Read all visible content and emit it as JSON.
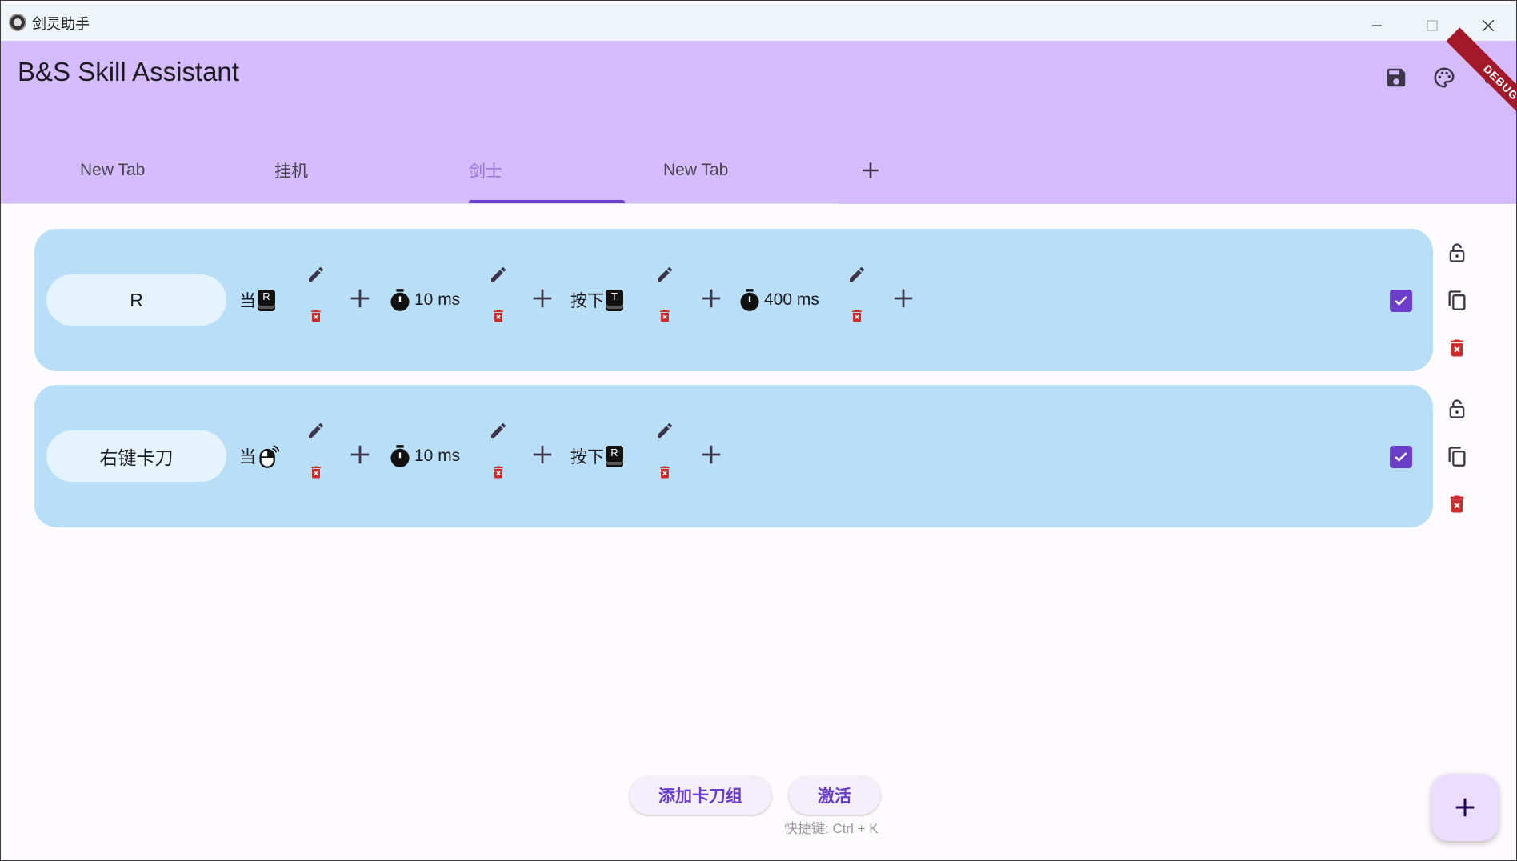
{
  "window": {
    "title": "剑灵助手"
  },
  "appbar": {
    "title": "B&S Skill Assistant",
    "debug_banner": "DEBUG"
  },
  "tabs": [
    {
      "label": "New Tab"
    },
    {
      "label": "挂机"
    },
    {
      "label": "剑士",
      "selected": true
    },
    {
      "label": "New Tab"
    }
  ],
  "rows": [
    {
      "name": "R",
      "trigger_label": "当",
      "trigger_key": "R",
      "delay1": "10 ms",
      "press_label": "按下",
      "press_key": "T",
      "delay2": "400 ms",
      "checked": true
    },
    {
      "name": "右键卡刀",
      "trigger_label": "当",
      "trigger_icon": "mouse-right-click-icon",
      "delay1": "10 ms",
      "press_label": "按下",
      "press_key": "R",
      "checked": true
    }
  ],
  "footer": {
    "add_group_label": "添加卡刀组",
    "activate_label": "激活",
    "shortcut_hint": "快捷键: Ctrl + K"
  },
  "colors": {
    "appbar": "#d4bcff",
    "row_bg": "#b9dff8",
    "accent": "#6a3ec8",
    "delete": "#d02b2b"
  }
}
